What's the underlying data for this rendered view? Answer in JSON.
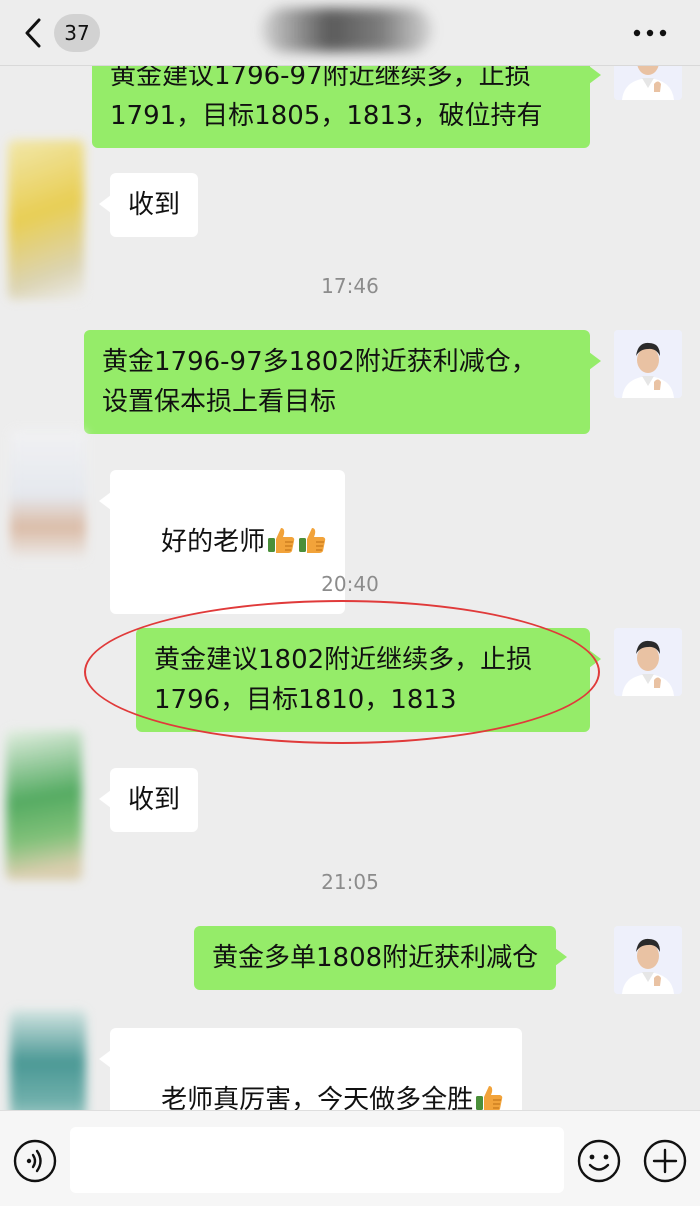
{
  "header": {
    "back_icon": "chevron-left-icon",
    "unread_count": "37",
    "more_icon": "more-dots-icon"
  },
  "messages": [
    {
      "side": "out",
      "text": "黄金建议1796-97附近继续多，止损\n1791，目标1805，1813，破位持有"
    },
    {
      "side": "in",
      "text": "收到"
    },
    {
      "type": "time",
      "text": "17:46"
    },
    {
      "side": "out",
      "text": "黄金1796-97多1802附近获利减仓，\n设置保本损上看目标"
    },
    {
      "side": "in",
      "text": "好的老师",
      "emoji": [
        "thumbs-up-icon",
        "thumbs-up-icon"
      ]
    },
    {
      "type": "time",
      "text": "20:40"
    },
    {
      "side": "out",
      "text": "黄金建议1802附近继续多，止损\n1796，目标1810，1813",
      "highlighted": true
    },
    {
      "side": "in",
      "text": "收到"
    },
    {
      "type": "time",
      "text": "21:05"
    },
    {
      "side": "out",
      "text": "黄金多单1808附近获利减仓"
    },
    {
      "side": "in",
      "text": "老师真厉害，今天做多全胜",
      "emoji": [
        "thumbs-up-icon"
      ]
    }
  ],
  "input_bar": {
    "voice_icon": "voice-icon",
    "input_value": "",
    "emoji_icon": "emoji-icon",
    "plus_icon": "plus-icon"
  },
  "colors": {
    "background": "#ededed",
    "outgoing_bubble": "#95ec69",
    "incoming_bubble": "#ffffff",
    "timestamp": "#8c8c8c",
    "highlight": "#e03a3a"
  }
}
